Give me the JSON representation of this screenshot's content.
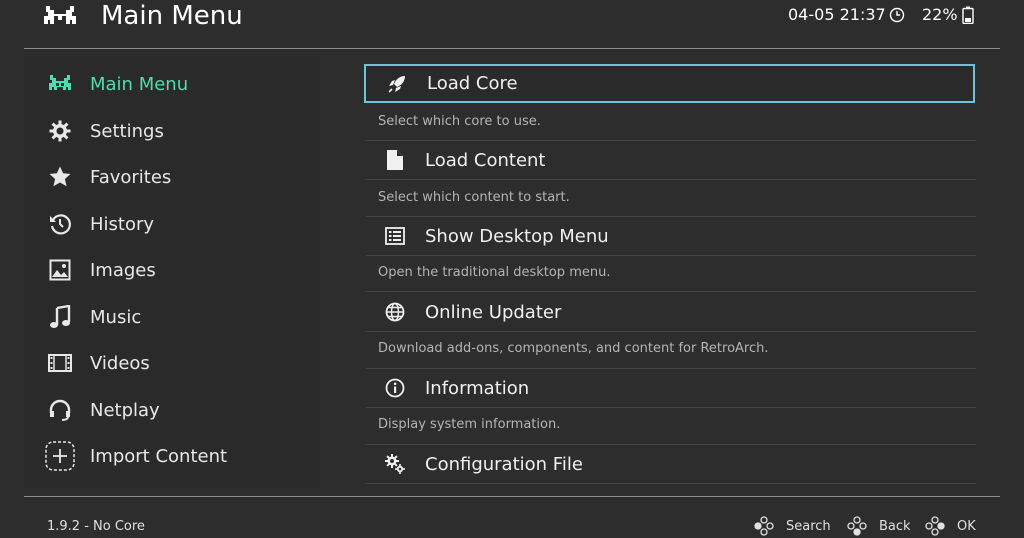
{
  "header": {
    "title": "Main Menu",
    "datetime": "04-05 21:37",
    "battery": "22%"
  },
  "sidebar": {
    "items": [
      {
        "label": "Main Menu",
        "icon": "invader-icon",
        "active": true
      },
      {
        "label": "Settings",
        "icon": "gear-icon"
      },
      {
        "label": "Favorites",
        "icon": "star-icon"
      },
      {
        "label": "History",
        "icon": "history-icon"
      },
      {
        "label": "Images",
        "icon": "image-icon"
      },
      {
        "label": "Music",
        "icon": "music-note-icon"
      },
      {
        "label": "Videos",
        "icon": "film-icon"
      },
      {
        "label": "Netplay",
        "icon": "headset-icon"
      },
      {
        "label": "Import Content",
        "icon": "plus-box-icon"
      }
    ]
  },
  "menu": {
    "entries": [
      {
        "label": "Load Core",
        "description": "Select which core to use.",
        "icon": "rocket-icon",
        "selected": true
      },
      {
        "label": "Load Content",
        "description": "Select which content to start.",
        "icon": "file-icon"
      },
      {
        "label": "Show Desktop Menu",
        "description": "Open the traditional desktop menu.",
        "icon": "list-icon"
      },
      {
        "label": "Online Updater",
        "description": "Download add-ons, components, and content for RetroArch.",
        "icon": "globe-icon"
      },
      {
        "label": "Information",
        "description": "Display system information.",
        "icon": "info-icon"
      },
      {
        "label": "Configuration File",
        "description": "",
        "icon": "cogs-icon"
      }
    ]
  },
  "footer": {
    "version": "1.9.2 - No Core",
    "search_label": "Search",
    "back_label": "Back",
    "ok_label": "OK"
  },
  "colors": {
    "background": "#2d2d2d",
    "accent": "#4fdcb2",
    "selection_border": "#6fc3d8"
  }
}
